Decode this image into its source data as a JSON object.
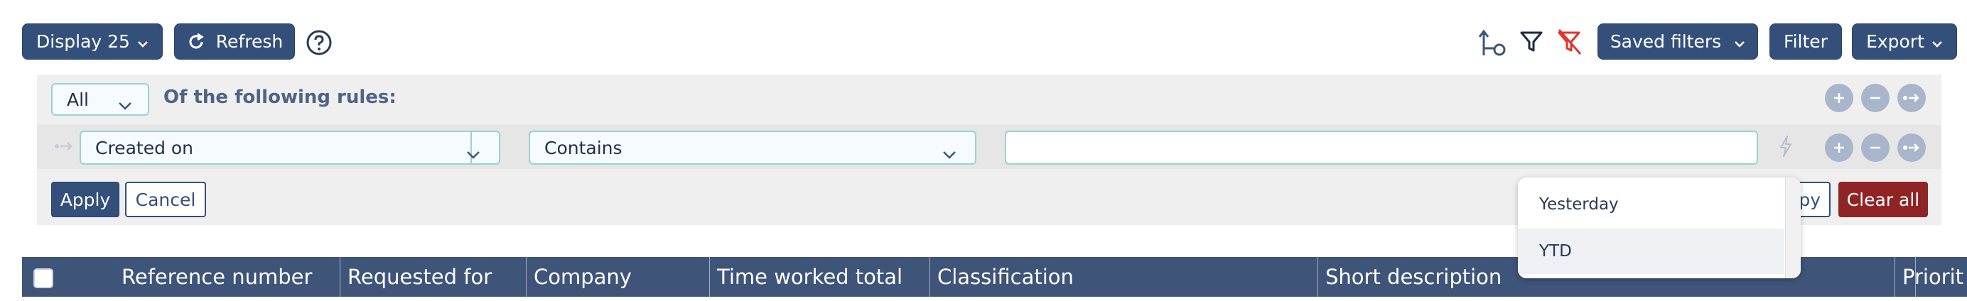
{
  "toolbar": {
    "display_label": "Display 25",
    "refresh_label": "Refresh",
    "help_icon": "question-circle-icon",
    "saved_filters_label": "Saved filters",
    "filter_label": "Filter",
    "export_label": "Export"
  },
  "filter_panel": {
    "match_select_value": "All",
    "rules_heading": "Of the following rules:",
    "rule": {
      "field_value": "Created on",
      "operator_value": "Contains",
      "value_input": ""
    },
    "apply_label": "Apply",
    "cancel_label": "Cancel",
    "apply_partial_label": "py",
    "clear_all_label": "Clear all"
  },
  "dropdown": {
    "options": [
      "Yesterday",
      "YTD"
    ],
    "highlighted_index": 1
  },
  "table": {
    "columns": [
      "Reference number",
      "Requested for",
      "Company",
      "Time worked total",
      "Classification",
      "Short description",
      "Priorit"
    ]
  },
  "colors": {
    "primary": "#34507a",
    "header": "#3f5479",
    "danger": "#8f2424",
    "accent_border": "#9ad2ce",
    "clear_filter_red": "#e0352b"
  }
}
